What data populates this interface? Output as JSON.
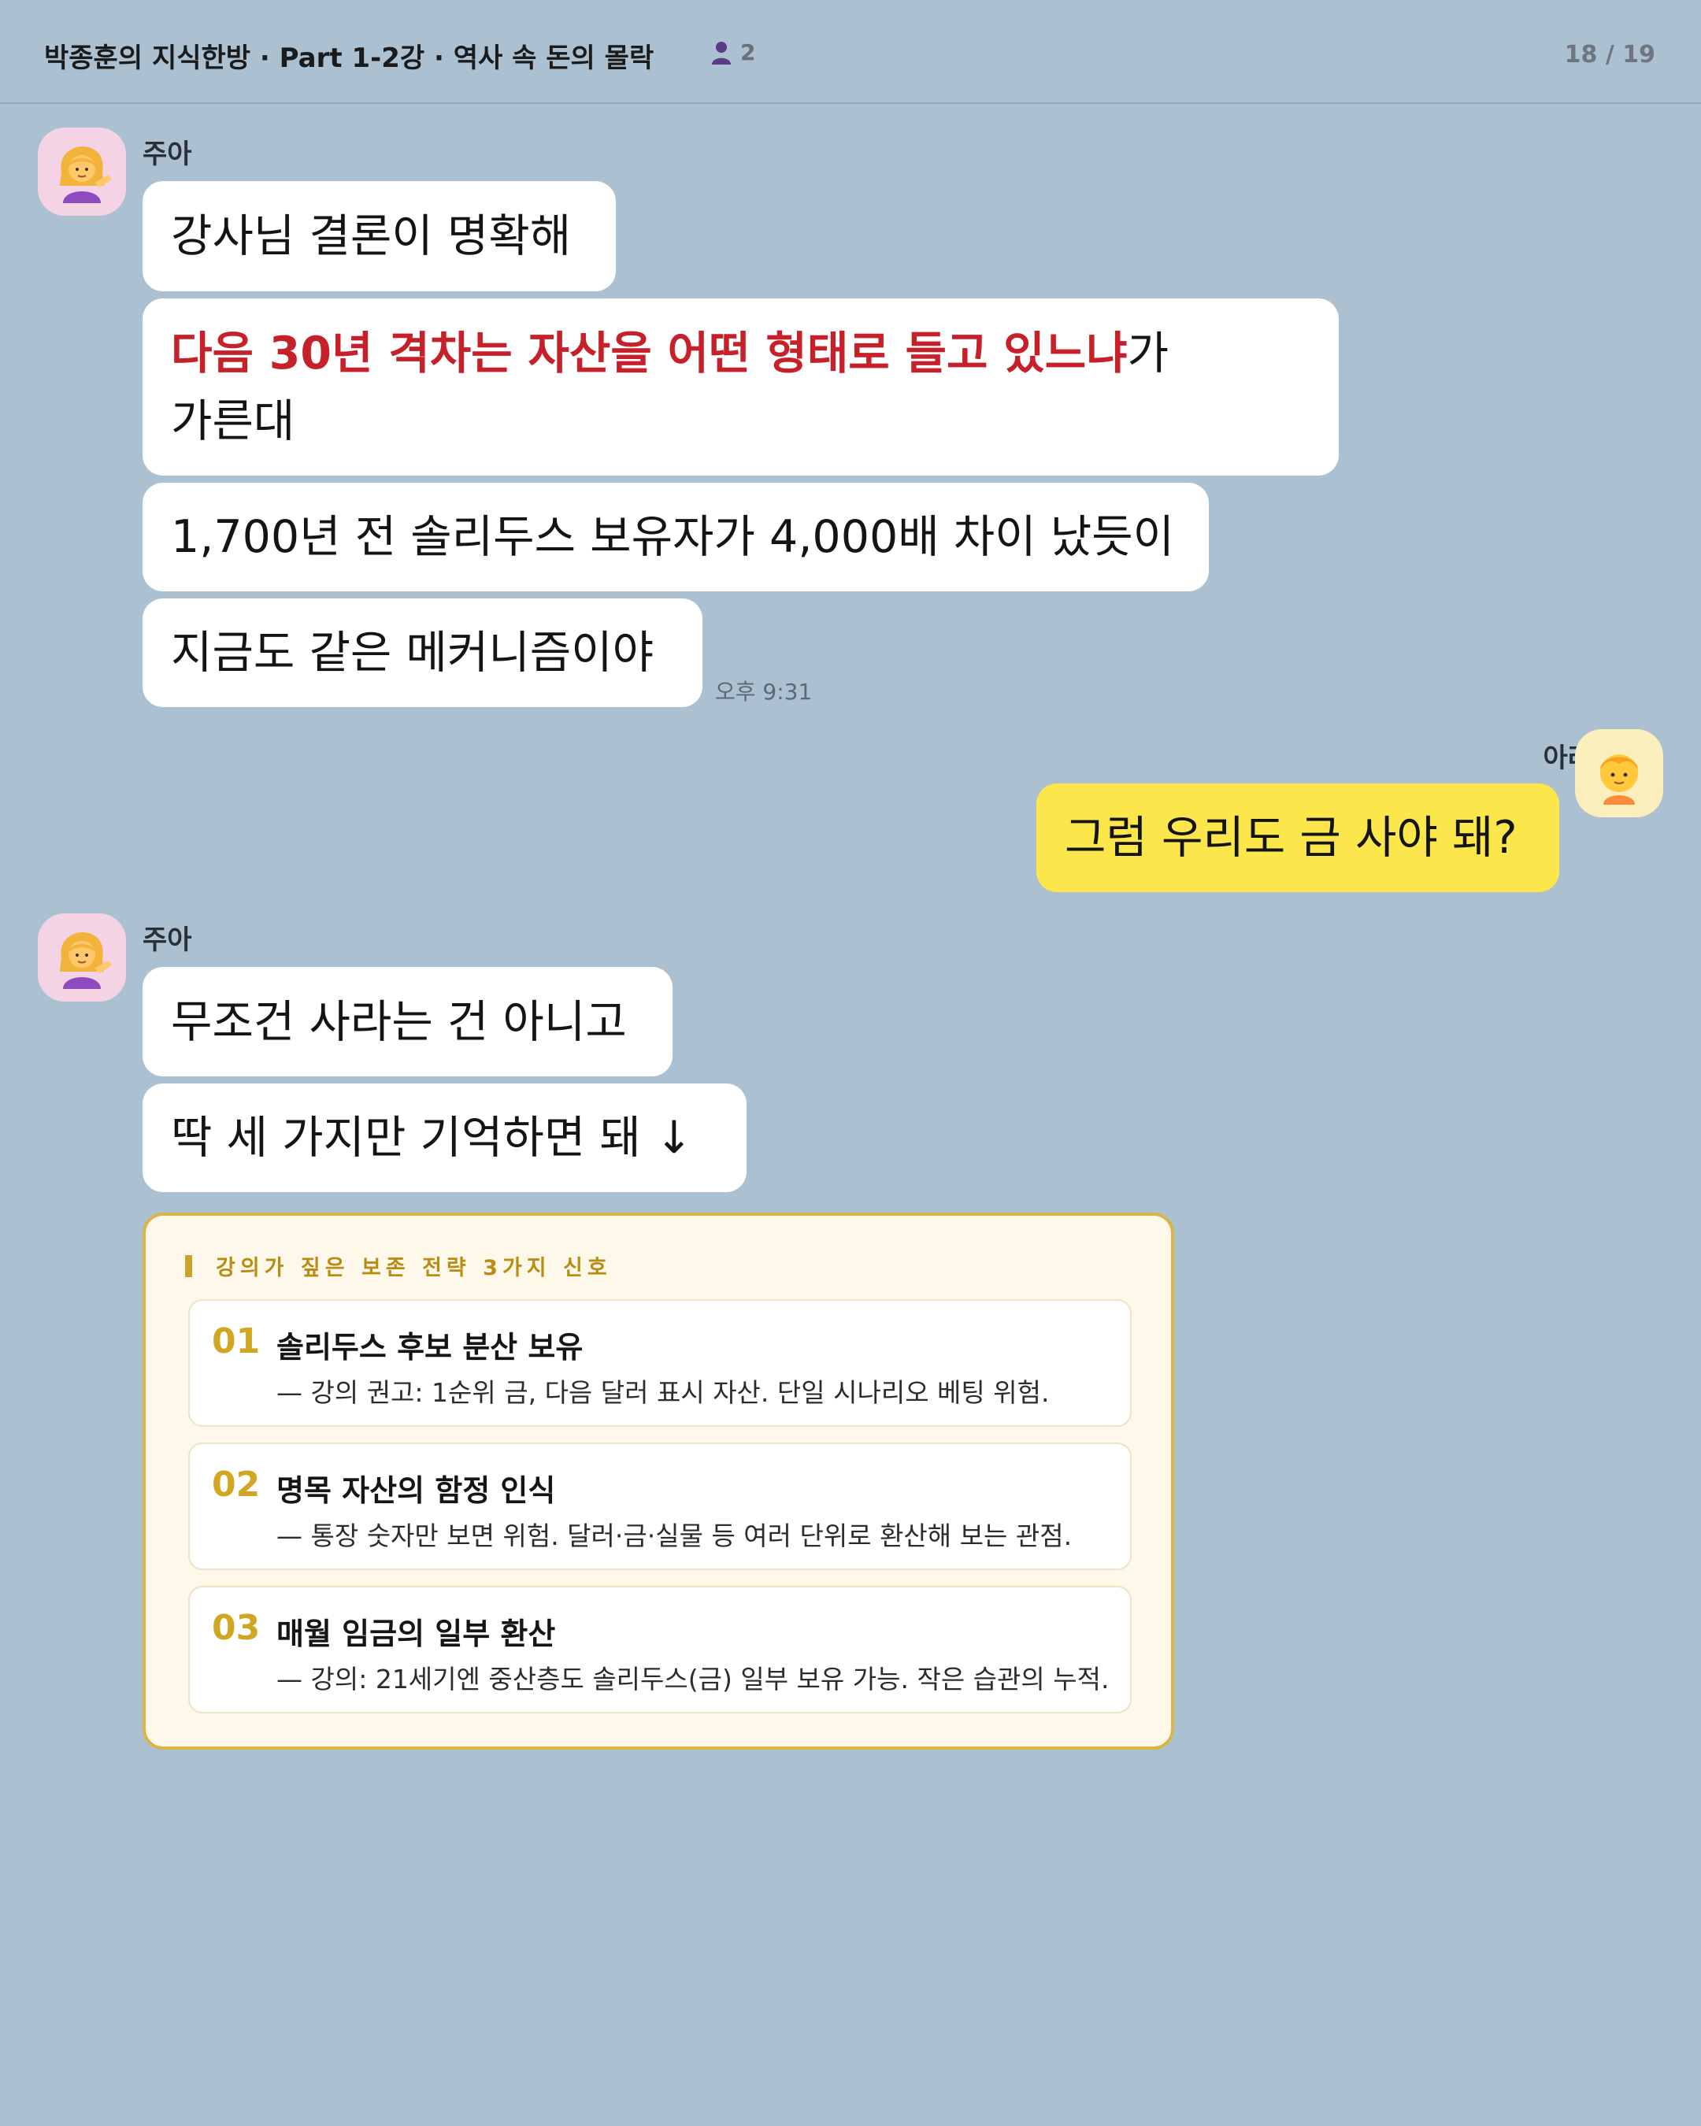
{
  "header": {
    "title": "박종훈의 지식한방 · Part 1-2강 · 역사 속 돈의 몰락",
    "member_count": "2",
    "page_counter": "18 / 19"
  },
  "messages": {
    "group1": {
      "sender": "주아",
      "avatar": "woman-tipping-hand-emoji",
      "bubble1": "강사님 결론이 명확해",
      "bubble2_highlight": "다음 30년 격차는 자산을 어떤 형태로 들고 있느냐",
      "bubble2_tail": "가",
      "bubble2_line2": "가른대",
      "bubble3": "1,700년 전 솔리두스 보유자가 4,000배 차이 났듯이",
      "bubble4": "지금도 같은 메커니즘이야",
      "time": "오후 9:31"
    },
    "group2": {
      "sender": "아라",
      "avatar": "child-emoji",
      "bubble1": "그럼 우리도 금 사야 돼?"
    },
    "group3": {
      "sender": "주아",
      "avatar": "woman-tipping-hand-emoji",
      "bubble1": "무조건 사라는 건 아니고",
      "bubble2": "딱 세 가지만 기억하면 돼 ↓"
    }
  },
  "card": {
    "heading": "강의가 짚은 보존 전략 3가지 신호",
    "items": [
      {
        "num": "01",
        "title": "솔리두스 후보 분산 보유",
        "desc": "— 강의 권고: 1순위 금, 다음 달러 표시 자산. 단일 시나리오 베팅 위험."
      },
      {
        "num": "02",
        "title": "명목 자산의 함정 인식",
        "desc": "— 통장 숫자만 보면 위험. 달러·금·실물 등 여러 단위로 환산해 보는 관점."
      },
      {
        "num": "03",
        "title": "매월 임금의 일부 환산",
        "desc": "— 강의: 21세기엔 중산층도 솔리두스(금) 일부 보유 가능. 작은 습관의 누적."
      }
    ]
  },
  "colors": {
    "background": "#abc1d2",
    "my_bubble": "#fbe64b",
    "highlight": "#c6202a",
    "card_accent": "#d1a623"
  }
}
